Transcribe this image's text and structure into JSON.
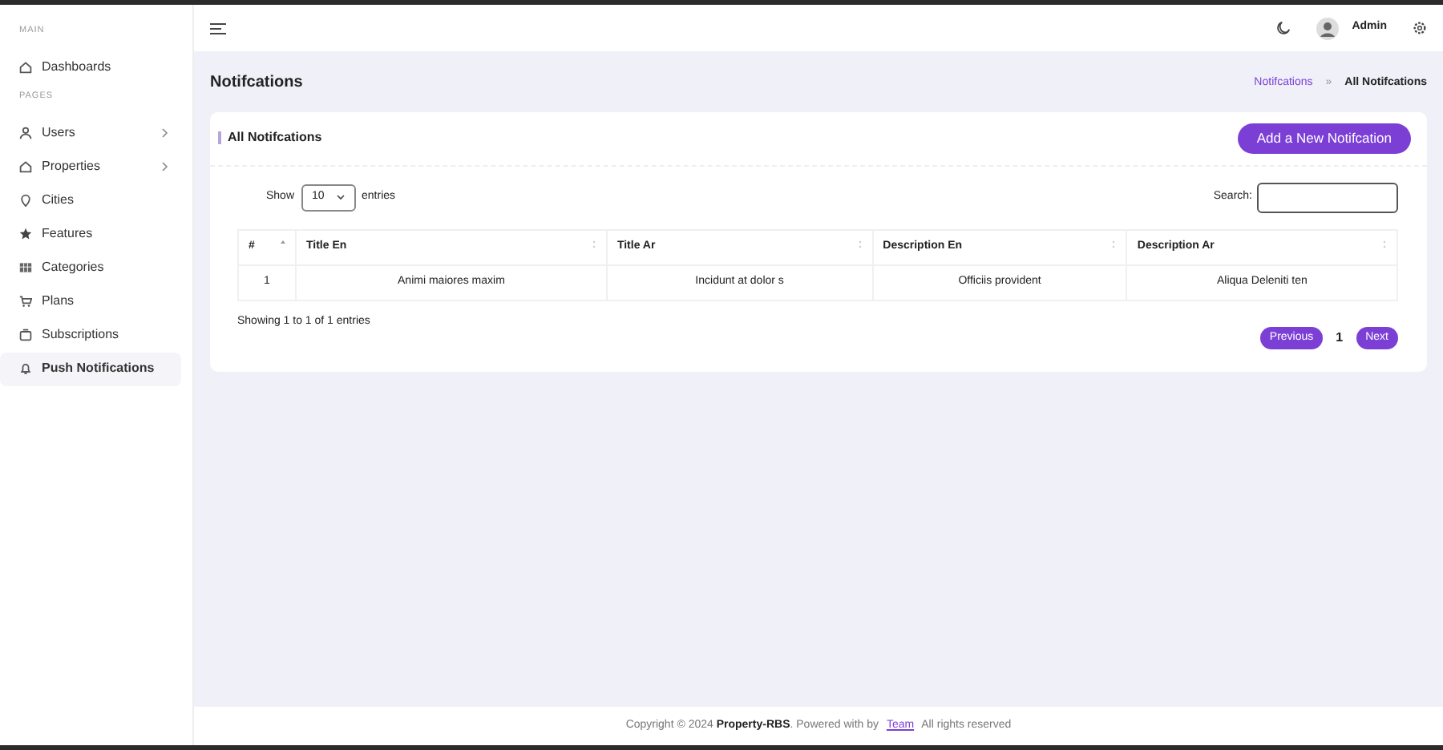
{
  "sidebar": {
    "sections": [
      {
        "label": "MAIN",
        "items": [
          {
            "label": "Dashboards",
            "has_submenu": false,
            "selected": false
          }
        ]
      },
      {
        "label": "PAGES",
        "items": [
          {
            "label": "Users",
            "has_submenu": true,
            "selected": false
          },
          {
            "label": "Properties",
            "has_submenu": true,
            "selected": false
          },
          {
            "label": "Cities",
            "has_submenu": false,
            "selected": false
          },
          {
            "label": "Features",
            "has_submenu": false,
            "selected": false
          },
          {
            "label": "Categories",
            "has_submenu": false,
            "selected": false
          },
          {
            "label": "Plans",
            "has_submenu": false,
            "selected": false
          },
          {
            "label": "Subscriptions",
            "has_submenu": false,
            "selected": false
          },
          {
            "label": "Push Notifications",
            "has_submenu": false,
            "selected": true
          }
        ]
      }
    ]
  },
  "header": {
    "user_name": "Admin"
  },
  "page": {
    "title": "Notifcations",
    "breadcrumb_separator": "»",
    "breadcrumb": [
      {
        "label": "Notifcations",
        "link": true
      },
      {
        "label": "All Notifcations",
        "link": false
      }
    ]
  },
  "card": {
    "title": "All Notifcations",
    "add_button": "Add a New Notifcation",
    "length": {
      "before": "Show",
      "value": "10",
      "after": "entries"
    },
    "search_label": "Search:",
    "table": {
      "columns": [
        "#",
        "Title En",
        "Title Ar",
        "Description En",
        "Description Ar"
      ],
      "rows": [
        [
          "1",
          "Animi maiores maxim",
          "Incidunt at dolor s",
          "Officiis provident",
          "Aliqua Deleniti ten"
        ]
      ]
    },
    "info": "Showing 1 to 1 of 1 entries",
    "pagination": {
      "previous": "Previous",
      "pages": [
        {
          "label": "1",
          "selected": true
        }
      ],
      "next": "Next"
    }
  },
  "footer": {
    "before": "Copyright © 2024 ",
    "brand": "Property-RBS",
    "middle": ". Powered with by ",
    "link": "Team",
    "after": " All rights reserved"
  }
}
